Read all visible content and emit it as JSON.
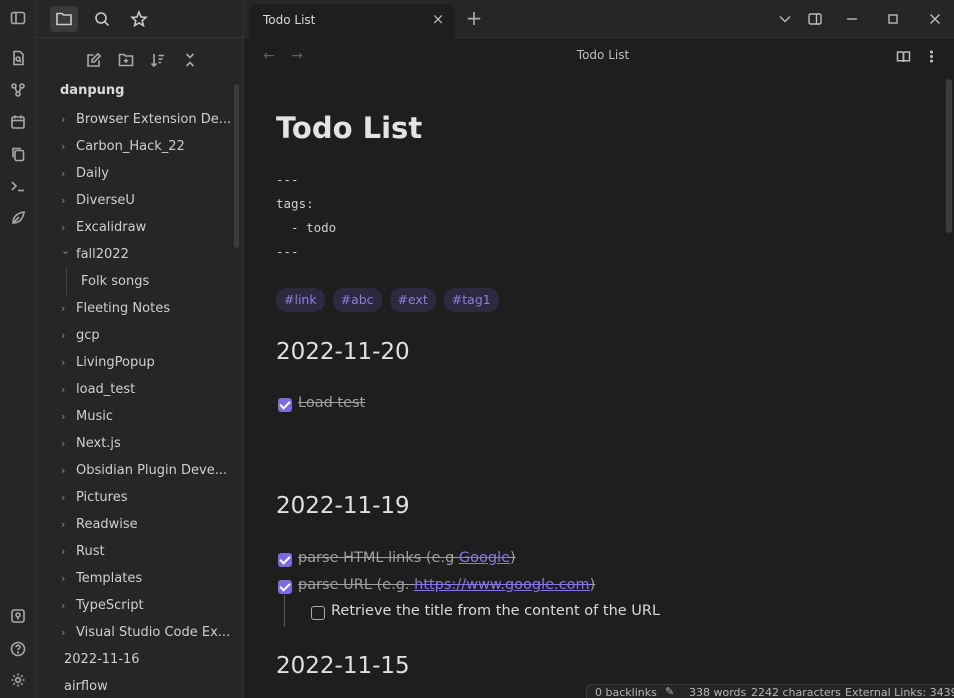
{
  "tab": {
    "title": "Todo List"
  },
  "view": {
    "title": "Todo List"
  },
  "sidebar": {
    "vault_name": "danpung",
    "items": [
      {
        "label": "Browser Extension De...",
        "type": "folder"
      },
      {
        "label": "Carbon_Hack_22",
        "type": "folder"
      },
      {
        "label": "Daily",
        "type": "folder"
      },
      {
        "label": "DiverseU",
        "type": "folder"
      },
      {
        "label": "Excalidraw",
        "type": "folder"
      },
      {
        "label": "fall2022",
        "type": "folder-open"
      },
      {
        "label": "Folk songs",
        "type": "child"
      },
      {
        "label": "Fleeting Notes",
        "type": "folder"
      },
      {
        "label": "gcp",
        "type": "folder"
      },
      {
        "label": "LivingPopup",
        "type": "folder"
      },
      {
        "label": "load_test",
        "type": "folder"
      },
      {
        "label": "Music",
        "type": "folder"
      },
      {
        "label": "Next.js",
        "type": "folder"
      },
      {
        "label": "Obsidian Plugin Deve...",
        "type": "folder"
      },
      {
        "label": "Pictures",
        "type": "folder"
      },
      {
        "label": "Readwise",
        "type": "folder"
      },
      {
        "label": "Rust",
        "type": "folder"
      },
      {
        "label": "Templates",
        "type": "folder"
      },
      {
        "label": "TypeScript",
        "type": "folder"
      },
      {
        "label": "Visual Studio Code Ex...",
        "type": "folder"
      },
      {
        "label": "2022-11-16",
        "type": "file"
      },
      {
        "label": "airflow",
        "type": "file"
      }
    ]
  },
  "note": {
    "title": "Todo List",
    "frontmatter": [
      "---",
      "tags:",
      "  - todo",
      "---"
    ],
    "tags": [
      "#link",
      "#abc",
      "#ext",
      "#tag1"
    ],
    "sections": [
      {
        "heading": "2022-11-20"
      },
      {
        "heading": "2022-11-19"
      },
      {
        "heading": "2022-11-15"
      }
    ],
    "tasks": {
      "load_test": "Load test",
      "parse_html_pre": "parse HTML links (e.g ",
      "parse_html_link": "Google",
      "parse_html_post": ")",
      "parse_url_pre": "parse URL (e.g. ",
      "parse_url_link": "https://www.google.com",
      "parse_url_post": ")",
      "retrieve_title": "Retrieve the title from the content of the URL"
    }
  },
  "status": {
    "backlinks": "0 backlinks",
    "words": "338 words",
    "characters": "2242 characters",
    "external_links": "External Links: 3439"
  },
  "colors": {
    "accent": "#7c6bdc",
    "link": "#8a75e8",
    "tag_bg": "#2c2a3e"
  }
}
